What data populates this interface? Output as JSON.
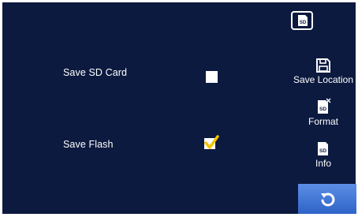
{
  "options": {
    "sd_card": {
      "label": "Save SD Card",
      "checked": false
    },
    "flash": {
      "label": "Save Flash",
      "checked": true
    }
  },
  "sidebar": {
    "top_icon": "sd-card-icon",
    "save_location": {
      "label": "Save Location",
      "icon": "floppy-disk-icon"
    },
    "format": {
      "label": "Format",
      "icon": "sd-card-format-icon",
      "icon_text": "SD"
    },
    "info": {
      "label": "Info",
      "icon": "sd-card-icon",
      "icon_text": "SD"
    },
    "back": {
      "icon": "back-arrow-icon"
    }
  },
  "colors": {
    "background": "#0c1a3f",
    "checkmark": "#f2c200",
    "back_button": "#3f74d8"
  }
}
